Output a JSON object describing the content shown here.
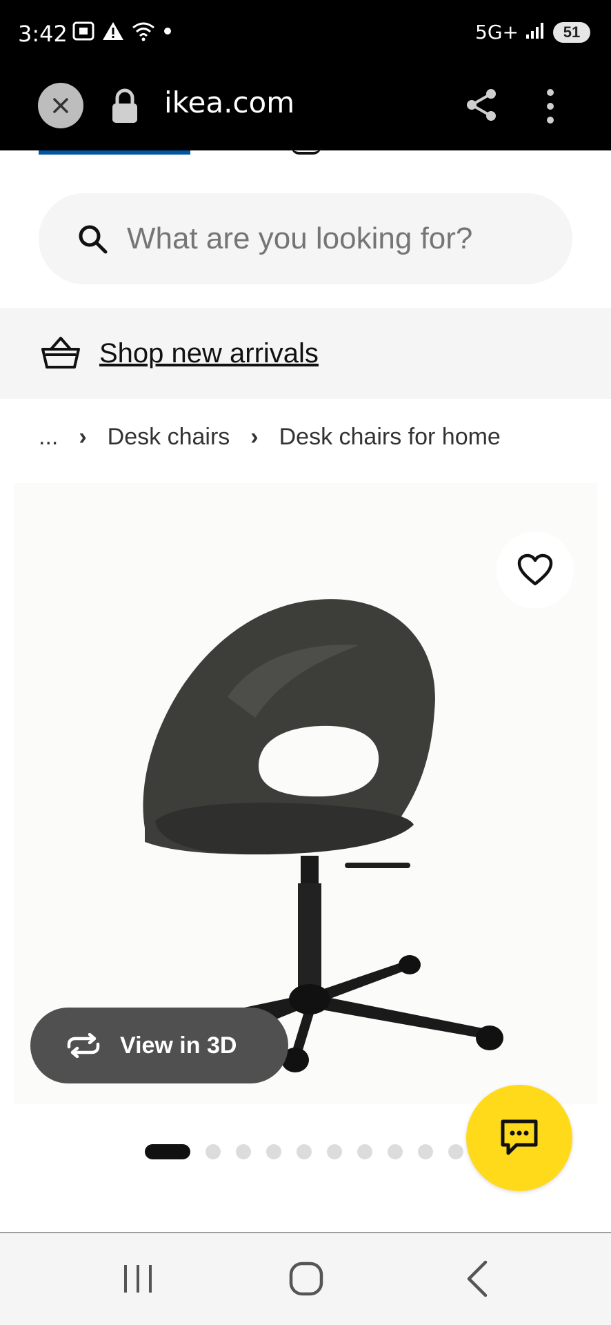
{
  "status_bar": {
    "time": "3:42",
    "network": "5G+",
    "battery": "51",
    "icons": [
      "screenshot-icon",
      "warning-icon",
      "wifi-icon",
      "dot-icon",
      "signal-icon"
    ]
  },
  "browser": {
    "url": "ikea.com",
    "icons": [
      "close-icon",
      "lock-icon",
      "share-icon",
      "more-vert-icon"
    ]
  },
  "search": {
    "placeholder": "What are you looking for?"
  },
  "promo": {
    "link": "Shop new arrivals"
  },
  "breadcrumb": {
    "items": [
      "...",
      "Desk chairs",
      "Desk chairs for home"
    ]
  },
  "product": {
    "view_3d_label": "View in 3D",
    "carousel": {
      "total": 10,
      "active": 1
    }
  },
  "colors": {
    "accent_blue": "#0058a3",
    "chat_yellow": "#ffda1a",
    "pill_grey": "#505050"
  }
}
